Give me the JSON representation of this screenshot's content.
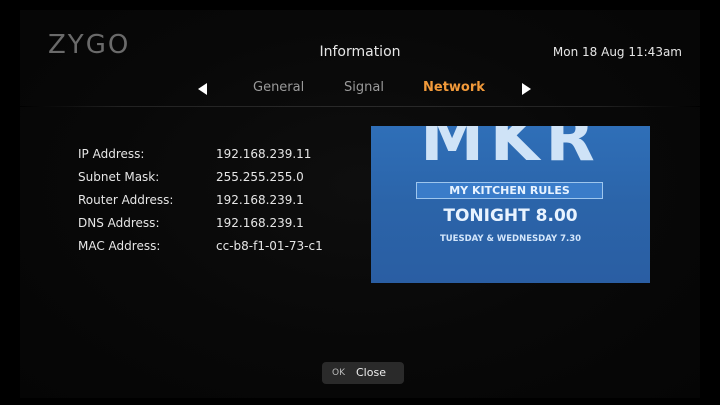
{
  "header": {
    "logo": "ZYGO",
    "title": "Information",
    "datetime": "Mon 18 Aug 11:43am"
  },
  "tabs": [
    {
      "label": "General",
      "active": false
    },
    {
      "label": "Signal",
      "active": false
    },
    {
      "label": "Network",
      "active": true
    }
  ],
  "network_info": [
    {
      "label": "IP Address:",
      "value": "192.168.239.11"
    },
    {
      "label": "Subnet Mask:",
      "value": "255.255.255.0"
    },
    {
      "label": "Router Address:",
      "value": "192.168.239.1"
    },
    {
      "label": "DNS Address:",
      "value": "192.168.239.1"
    },
    {
      "label": "MAC Address:",
      "value": "cc-b8-f1-01-73-c1"
    }
  ],
  "preview": {
    "brand": "MKR",
    "banner": "MY KITCHEN RULES",
    "headline": "TONIGHT 8.00",
    "subline": "TUESDAY & WEDNESDAY 7.30"
  },
  "footer": {
    "ok_key": "OK",
    "ok_label": "Close"
  },
  "colors": {
    "accent": "#f29a3a",
    "background": "#000000",
    "text": "#e6e6e6",
    "inactive_tab": "#9a9a9a",
    "preview_blue": "#2f6fb8"
  },
  "icons": {
    "prev": "arrow-left-icon",
    "next": "arrow-right-icon"
  }
}
